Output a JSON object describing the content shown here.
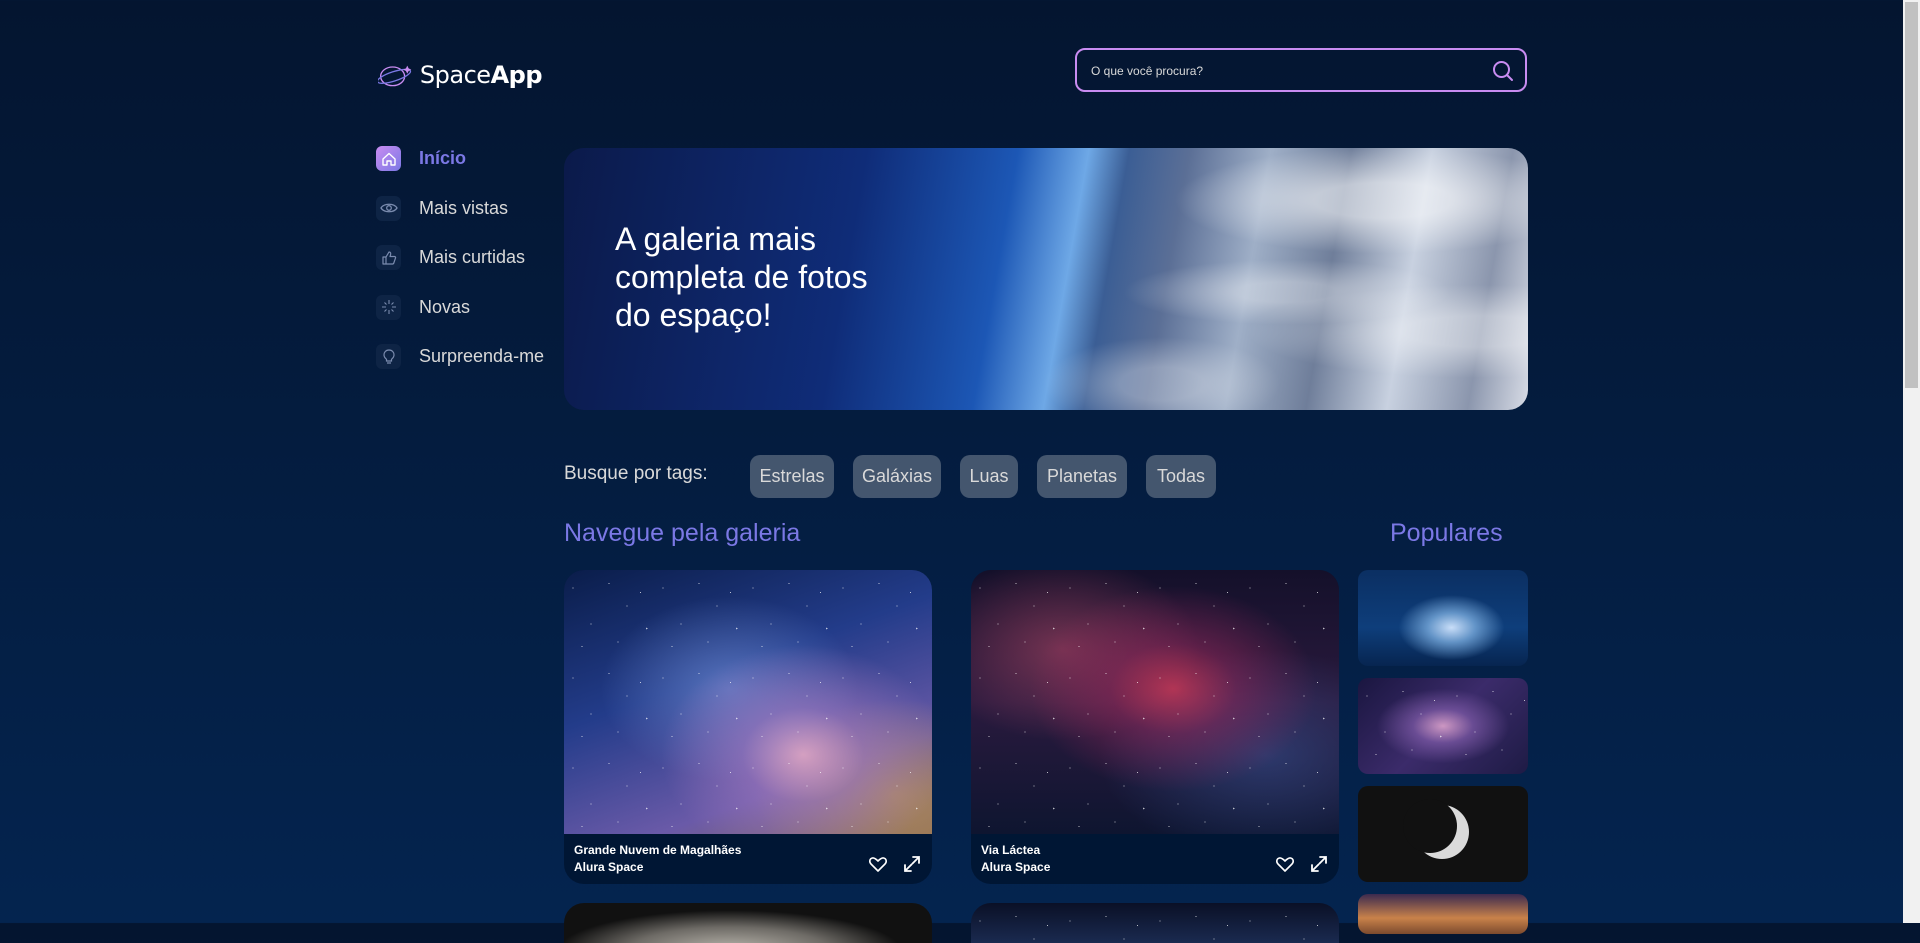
{
  "header": {
    "logo_text_light": "Space",
    "logo_text_bold": "App",
    "search_placeholder": "O que você procura?"
  },
  "sidebar": {
    "items": [
      {
        "label": "Início",
        "icon": "home-icon",
        "active": true
      },
      {
        "label": "Mais vistas",
        "icon": "eye-icon",
        "active": false
      },
      {
        "label": "Mais curtidas",
        "icon": "thumbs-up-icon",
        "active": false
      },
      {
        "label": "Novas",
        "icon": "sparkle-icon",
        "active": false
      },
      {
        "label": "Surpreenda-me",
        "icon": "lightbulb-icon",
        "active": false
      }
    ]
  },
  "banner": {
    "title": "A galeria mais completa de fotos do espaço!"
  },
  "tags": {
    "label": "Busque por tags:",
    "items": [
      "Estrelas",
      "Galáxias",
      "Luas",
      "Planetas",
      "Todas"
    ]
  },
  "gallery": {
    "heading": "Navegue pela galeria",
    "cards": [
      {
        "title": "Grande Nuvem de Magalhães",
        "source": "Alura Space"
      },
      {
        "title": "Via Láctea",
        "source": "Alura Space"
      }
    ]
  },
  "popular": {
    "heading": "Populares"
  },
  "colors": {
    "accent": "#7B78E5",
    "accent_light": "#C98CF1",
    "background_top": "#041530",
    "background_bottom": "#04244F",
    "text": "#D9D9D9"
  }
}
